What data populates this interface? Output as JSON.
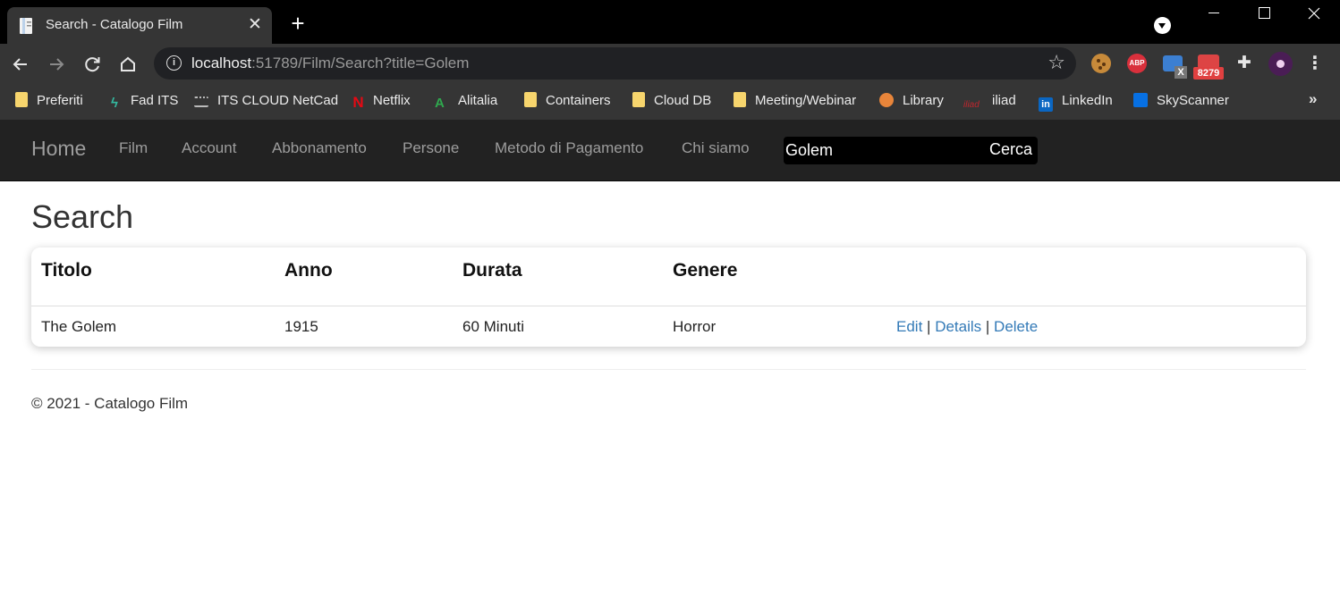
{
  "browser": {
    "tab": {
      "title": "Search - Catalogo Film",
      "close_glyph": "✕"
    },
    "new_tab_glyph": "+",
    "address": {
      "host": "localhost",
      "path": ":51789/Film/Search?title=Golem"
    },
    "extensions": {
      "abp_label": "ABP",
      "window_badge": "X",
      "mail_badge": "8279"
    },
    "bookmarks": [
      {
        "label": "Preferiti",
        "icon": "folder-icon"
      },
      {
        "label": "Fad ITS",
        "icon": "fad-icon"
      },
      {
        "label": "ITS CLOUD NetCad",
        "icon": "cisco-icon"
      },
      {
        "label": "Netflix",
        "icon": "netflix-icon"
      },
      {
        "label": "Alitalia",
        "icon": "alitalia-icon"
      },
      {
        "label": "Containers",
        "icon": "folder-icon"
      },
      {
        "label": "Cloud DB",
        "icon": "folder-icon"
      },
      {
        "label": "Meeting/Webinar",
        "icon": "folder-icon"
      },
      {
        "label": "Library",
        "icon": "library-icon"
      },
      {
        "label": "iliad",
        "icon": "iliad-icon"
      },
      {
        "label": "LinkedIn",
        "icon": "linkedin-icon"
      },
      {
        "label": "SkyScanner",
        "icon": "skyscanner-icon"
      }
    ],
    "bookmarks_more": "»"
  },
  "navbar": {
    "brand": "Home",
    "links": [
      "Film",
      "Account",
      "Abbonamento",
      "Persone",
      "Metodo di Pagamento",
      "Chi siamo"
    ],
    "search": {
      "value": "Golem",
      "button": "Cerca"
    }
  },
  "page": {
    "title": "Search",
    "table": {
      "headers": [
        "Titolo",
        "Anno",
        "Durata",
        "Genere"
      ],
      "rows": [
        {
          "titolo": "The Golem",
          "anno": "1915",
          "durata": "60 Minuti",
          "genere": "Horror",
          "actions": [
            "Edit",
            "Details",
            "Delete"
          ],
          "separator": "|"
        }
      ]
    },
    "footer": "© 2021 - Catalogo Film"
  }
}
